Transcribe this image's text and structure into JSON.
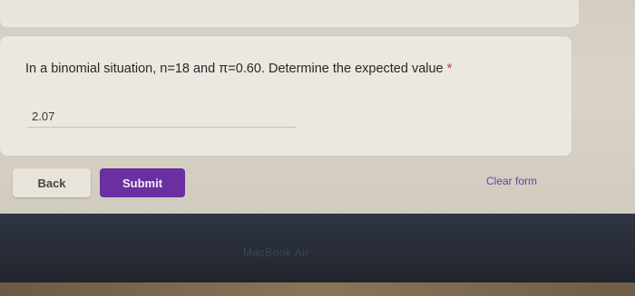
{
  "question": {
    "text": "In a binomial situation, n=18 and π=0.60. Determine the expected value",
    "required_marker": "*",
    "answer_value": "2.07"
  },
  "actions": {
    "back_label": "Back",
    "submit_label": "Submit",
    "clear_label": "Clear form"
  },
  "device": {
    "brand_text": "MacBook Air"
  },
  "colors": {
    "accent": "#6a2fa0",
    "required": "#d93025",
    "link": "#6a3fa8"
  }
}
